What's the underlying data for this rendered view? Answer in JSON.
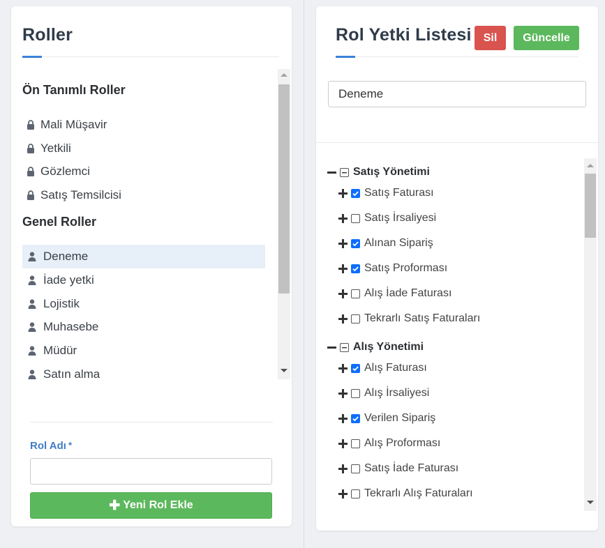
{
  "left_panel": {
    "title": "Roller",
    "predefined_heading": "Ön Tanımlı Roller",
    "predefined_roles": [
      "Mali Müşavir",
      "Yetkili",
      "Gözlemci",
      "Satış Temsilcisi"
    ],
    "general_heading": "Genel Roller",
    "general_roles": [
      "Deneme",
      "İade yetki",
      "Lojistik",
      "Muhasebe",
      "Müdür",
      "Satın alma"
    ],
    "selected_role": "Deneme",
    "form": {
      "label": "Rol Adı",
      "required_mark": "*",
      "input_value": "",
      "add_button_label": "Yeni Rol Ekle"
    }
  },
  "right_panel": {
    "title": "Rol Yetki Listesi",
    "delete_button": "Sil",
    "update_button": "Güncelle",
    "role_name_value": "Deneme",
    "groups": [
      {
        "label": "Satış Yönetimi",
        "items": [
          {
            "label": "Satış Faturası",
            "checked": true
          },
          {
            "label": "Satış İrsaliyesi",
            "checked": false
          },
          {
            "label": "Alınan Sipariş",
            "checked": true
          },
          {
            "label": "Satış Proforması",
            "checked": true
          },
          {
            "label": "Alış İade Faturası",
            "checked": false
          },
          {
            "label": "Tekrarlı Satış Faturaları",
            "checked": false
          }
        ]
      },
      {
        "label": "Alış Yönetimi",
        "items": [
          {
            "label": "Alış Faturası",
            "checked": true
          },
          {
            "label": "Alış İrsaliyesi",
            "checked": false
          },
          {
            "label": "Verilen Sipariş",
            "checked": true
          },
          {
            "label": "Alış Proforması",
            "checked": false
          },
          {
            "label": "Satış İade Faturası",
            "checked": false
          },
          {
            "label": "Tekrarlı Alış Faturaları",
            "checked": false
          }
        ]
      }
    ]
  },
  "colors": {
    "accent": "#3b82d9",
    "success": "#5cb85c",
    "danger": "#d9534f",
    "checkbox": "#0d6efd",
    "selected_row": "#e7eff8"
  },
  "icons": {
    "predefined_role": "lock-icon",
    "general_role": "user-icon",
    "expanded": "minus-icon",
    "collapsed": "plus-icon"
  }
}
